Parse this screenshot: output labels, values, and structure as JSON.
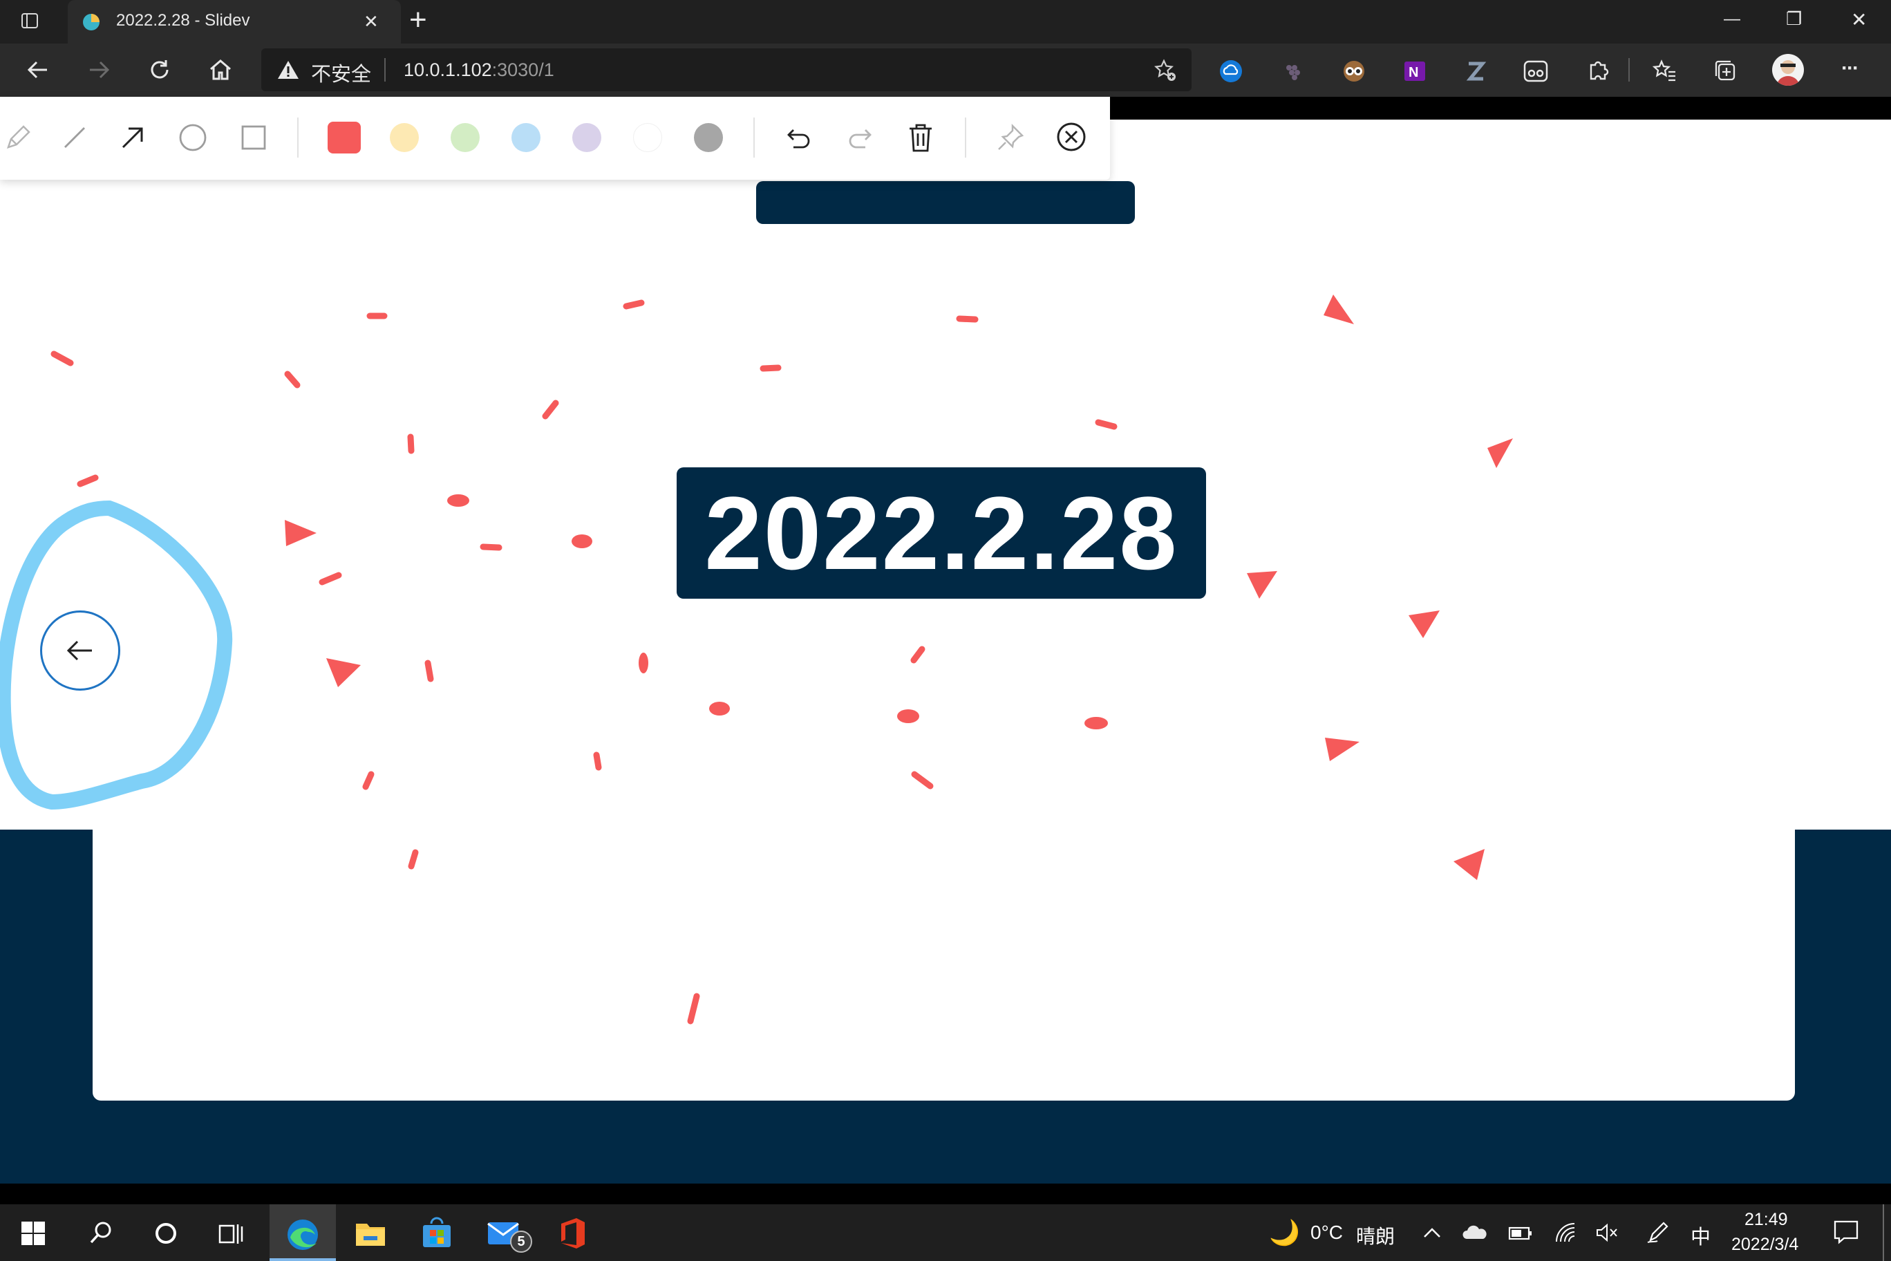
{
  "browser": {
    "tab_title": "2022.2.28 - Slidev",
    "new_tab": "+",
    "window_controls": {
      "minimize": "—",
      "maximize": "❐",
      "close": "✕"
    },
    "security_label": "不安全",
    "url_host": "10.0.1.102",
    "url_path": ":3030/1",
    "more": "···"
  },
  "slide": {
    "title": "2022.2.28",
    "colors": {
      "navy": "#012945",
      "confetti": "#f55a5a",
      "circle": "#7fd0f7"
    }
  },
  "drawing_toolbar": {
    "tools": [
      "pencil-icon",
      "line-icon",
      "arrow-icon",
      "ellipse-icon",
      "rectangle-icon"
    ],
    "colors": [
      "#f55a5a",
      "#fde9b3",
      "#d3edc4",
      "#b9def7",
      "#d9d1ea",
      "#ffffff",
      "#a6a6a6"
    ],
    "actions": [
      "undo-icon",
      "redo-icon",
      "trash-icon",
      "pin-icon",
      "close-circle-icon"
    ]
  },
  "taskbar": {
    "weather_temp": "0°C",
    "weather_text": "晴朗",
    "ime": "中",
    "time": "21:49",
    "date": "2022/3/4",
    "mail_badge": "5"
  }
}
